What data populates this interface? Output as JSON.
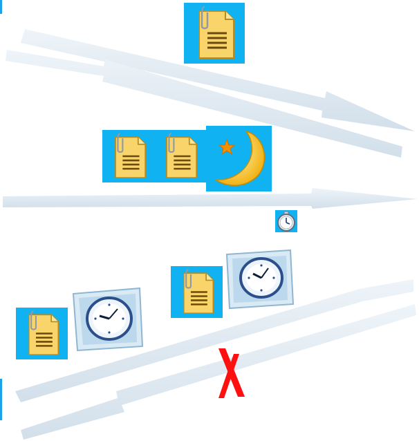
{
  "scene": {
    "background": "#ffffff",
    "tile_color": "#10b2f2",
    "arrow_color": "#dde8f1",
    "arrow_shade": "#c7d6e3",
    "cross_color": "#ff1010"
  },
  "icons": [
    {
      "name": "document-icon",
      "kind": "document"
    },
    {
      "name": "document-icon",
      "kind": "document"
    },
    {
      "name": "document-icon",
      "kind": "document"
    },
    {
      "name": "moon-star-icon",
      "kind": "moon"
    },
    {
      "name": "stopwatch-icon",
      "kind": "stopwatch"
    },
    {
      "name": "document-icon",
      "kind": "document"
    },
    {
      "name": "clock-icon",
      "kind": "clock"
    },
    {
      "name": "document-icon",
      "kind": "document"
    },
    {
      "name": "clock-icon",
      "kind": "clock"
    },
    {
      "name": "red-cross-icon",
      "kind": "cross"
    }
  ]
}
